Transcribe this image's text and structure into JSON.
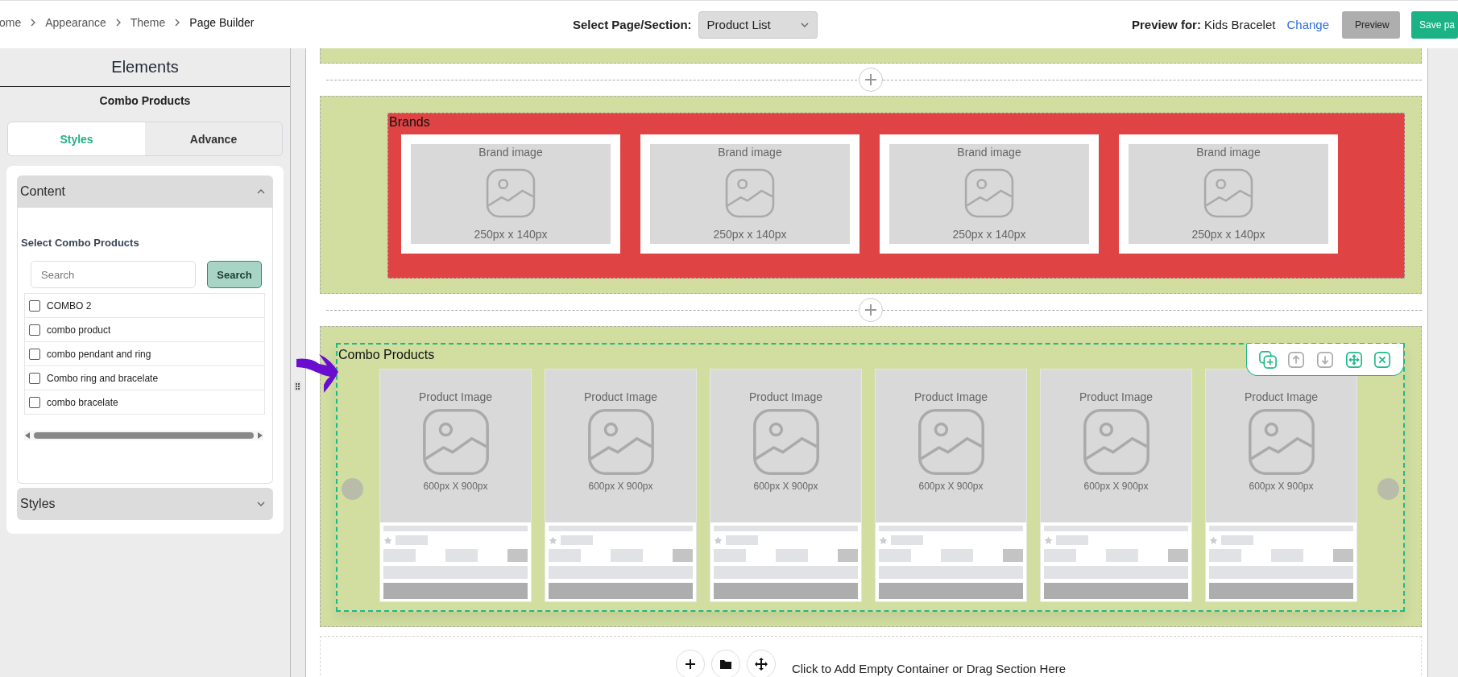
{
  "breadcrumb": [
    {
      "label": "ome"
    },
    {
      "label": "Appearance"
    },
    {
      "label": "Theme"
    },
    {
      "label": "Page Builder"
    }
  ],
  "page_select": {
    "label": "Select Page/Section:",
    "value": "Product List"
  },
  "preview": {
    "label": "Preview for:",
    "product": "Kids Bracelet",
    "change_link": "Change"
  },
  "buttons": [
    {
      "label": "Preview",
      "kind": "secondary"
    },
    {
      "label": "Save pa",
      "kind": "primary"
    }
  ],
  "sidebar": {
    "title": "Elements",
    "subtitle": "Combo Products",
    "tabs": [
      {
        "label": "Styles",
        "selected": true
      },
      {
        "label": "Advance",
        "selected": false
      }
    ],
    "sections": [
      {
        "title": "Content",
        "expanded": true,
        "body": {
          "label": "Select Combo Products",
          "search_placeholder": "Search",
          "search_button": "Search",
          "items": [
            {
              "label": "COMBO 2",
              "checked": false
            },
            {
              "label": "combo product",
              "checked": false
            },
            {
              "label": "combo pendant and ring",
              "checked": false
            },
            {
              "label": "Combo ring and bracelate",
              "checked": false
            },
            {
              "label": "combo bracelate",
              "checked": false
            }
          ]
        }
      },
      {
        "title": "Styles",
        "expanded": false
      }
    ]
  },
  "canvas": {
    "brands": {
      "title": "Brands",
      "cards": [
        {
          "label": "Brand image",
          "size": "250px x 140px"
        },
        {
          "label": "Brand image",
          "size": "250px x 140px"
        },
        {
          "label": "Brand image",
          "size": "250px x 140px"
        },
        {
          "label": "Brand image",
          "size": "250px x 140px"
        }
      ]
    },
    "combo": {
      "title": "Combo Products",
      "toolbar": [
        {
          "kind": "duplicate",
          "disabled": false
        },
        {
          "kind": "move_up",
          "disabled": true
        },
        {
          "kind": "move_down",
          "disabled": true
        },
        {
          "kind": "drag",
          "disabled": false
        },
        {
          "kind": "remove",
          "disabled": false
        }
      ],
      "cards": [
        {
          "label": "Product Image",
          "size": "600px X 900px"
        },
        {
          "label": "Product Image",
          "size": "600px X 900px"
        },
        {
          "label": "Product Image",
          "size": "600px X 900px"
        },
        {
          "label": "Product Image",
          "size": "600px X 900px"
        },
        {
          "label": "Product Image",
          "size": "600px X 900px"
        },
        {
          "label": "Product Image",
          "size": "600px X 900px"
        }
      ]
    },
    "empty_container": {
      "text": "Click to Add Empty Container or Drag Section Here"
    }
  }
}
